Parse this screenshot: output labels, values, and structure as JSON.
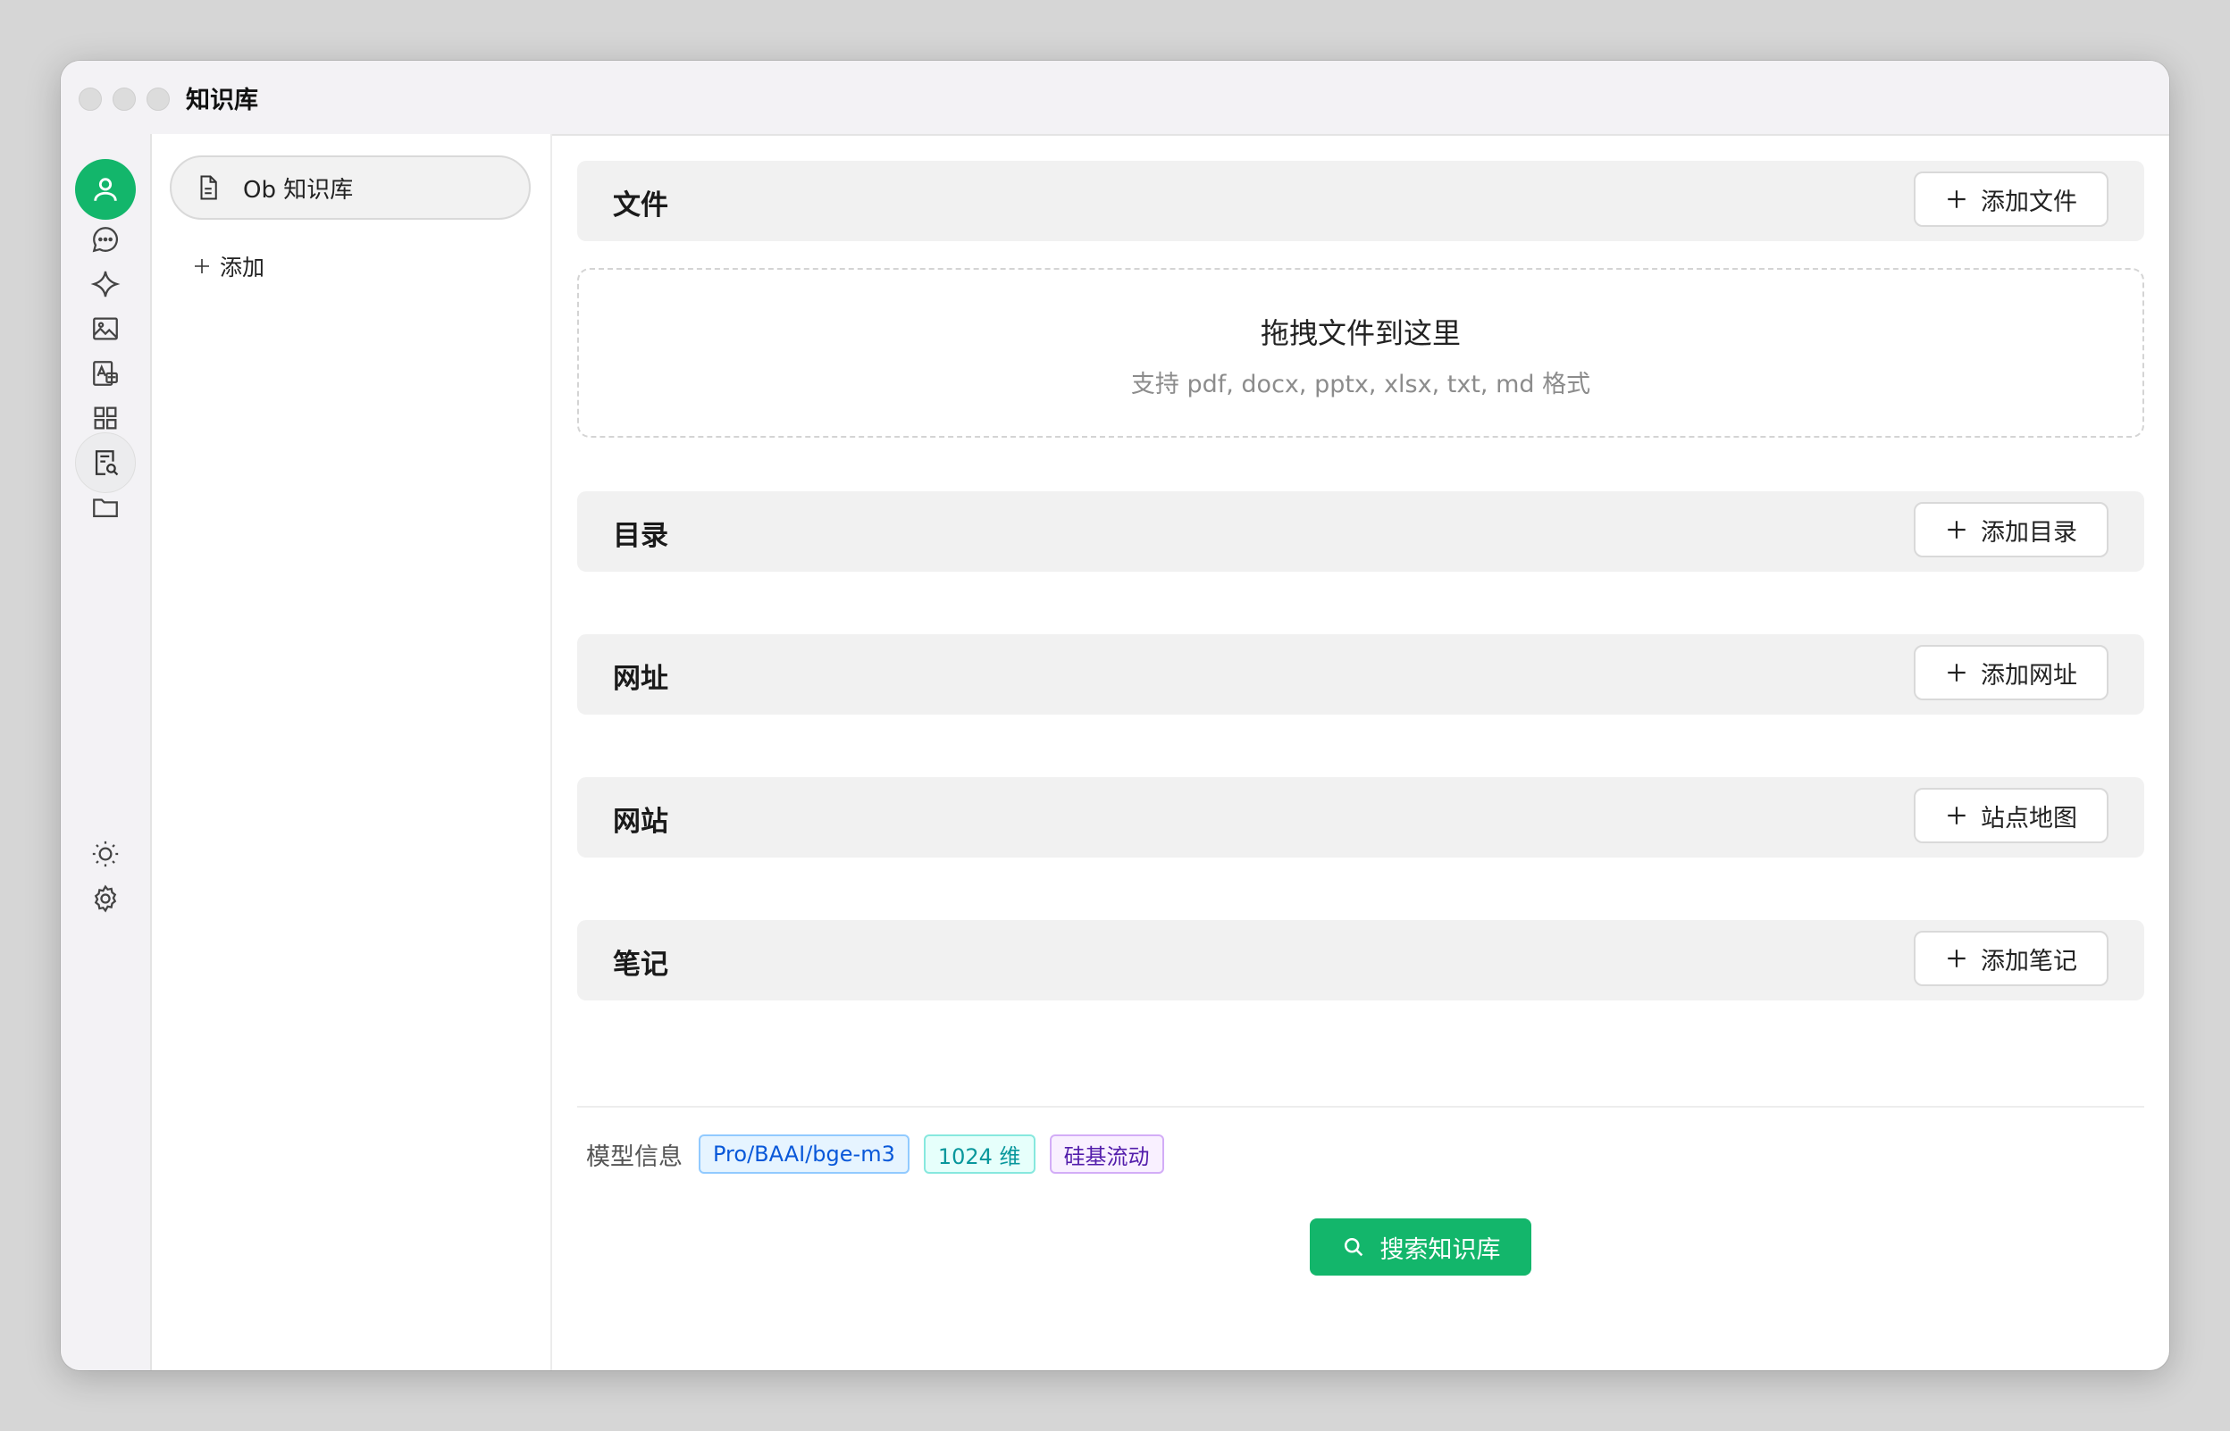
{
  "window": {
    "title": "知识库"
  },
  "rail": {
    "items": [
      "avatar",
      "chat-icon",
      "sparkle-icon",
      "image-icon",
      "translate-icon",
      "apps-grid-icon",
      "knowledge-search-icon",
      "folder-icon"
    ],
    "bottom": [
      "sun-icon",
      "gear-icon"
    ],
    "active": "knowledge-search-icon",
    "accent": "#13b66b"
  },
  "kb_panel": {
    "items": [
      {
        "label": "Ob 知识库"
      }
    ],
    "add_label": "添加"
  },
  "sections": {
    "files": {
      "title": "文件",
      "button": "添加文件"
    },
    "dirs": {
      "title": "目录",
      "button": "添加目录"
    },
    "urls": {
      "title": "网址",
      "button": "添加网址"
    },
    "sites": {
      "title": "网站",
      "button": "站点地图"
    },
    "notes": {
      "title": "笔记",
      "button": "添加笔记"
    }
  },
  "dropzone": {
    "title": "拖拽文件到这里",
    "subtitle": "支持 pdf, docx, pptx, xlsx, txt, md 格式"
  },
  "model_info": {
    "label": "模型信息",
    "tags": [
      "Pro/BAAI/bge-m3",
      "1024 维",
      "硅基流动"
    ]
  },
  "search_button": "搜索知识库"
}
